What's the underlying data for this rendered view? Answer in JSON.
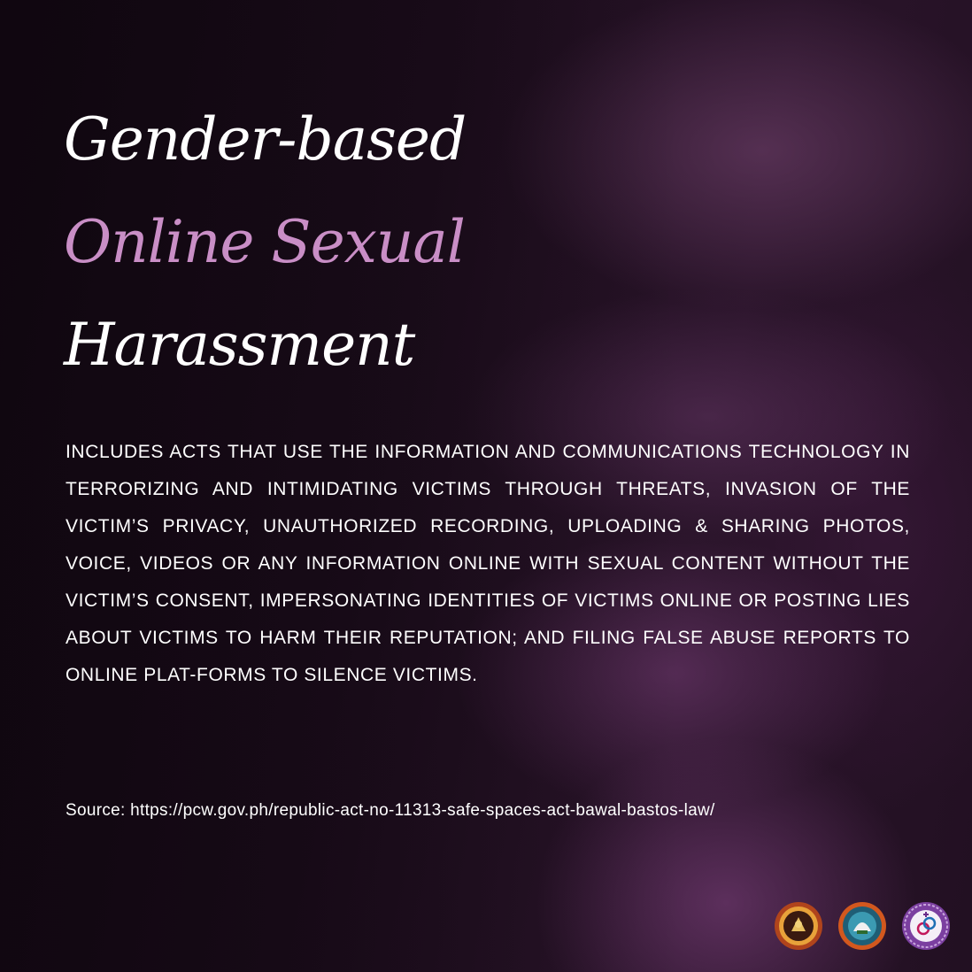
{
  "title": {
    "line1": "Gender-based",
    "line2": "Online Sexual",
    "line3": "Harassment"
  },
  "body": "INCLUDES ACTS THAT USE THE INFORMATION AND COMMUNICATIONS TECHNOLOGY IN TERRORIZING AND INTIMIDATING VICTIMS THROUGH THREATS, INVASION OF THE VICTIM’S PRIVACY, UNAUTHORIZED RECORDING, UPLOADING & SHARING PHOTOS, VOICE, VIDEOS OR ANY INFORMATION ONLINE WITH SEXUAL CONTENT WITHOUT THE VICTIM’S CONSENT, IMPERSONATING IDENTITIES OF VICTIMS ONLINE OR POSTING LIES ABOUT VICTIMS TO HARM THEIR REPUTATION; AND FILING FALSE ABUSE REPORTS TO ONLINE PLAT-FORMS TO SILENCE VICTIMS.",
  "source": "Source: https://pcw.gov.ph/republic-act-no-11313-safe-spaces-act-bawal-bastos-law/",
  "colors": {
    "background": "#1c0d1c",
    "accent": "#c98ec6",
    "text": "#ffffff"
  },
  "logos": [
    {
      "icon": "university-seal-icon"
    },
    {
      "icon": "office-seal-icon"
    },
    {
      "icon": "gender-development-seal-icon"
    }
  ]
}
